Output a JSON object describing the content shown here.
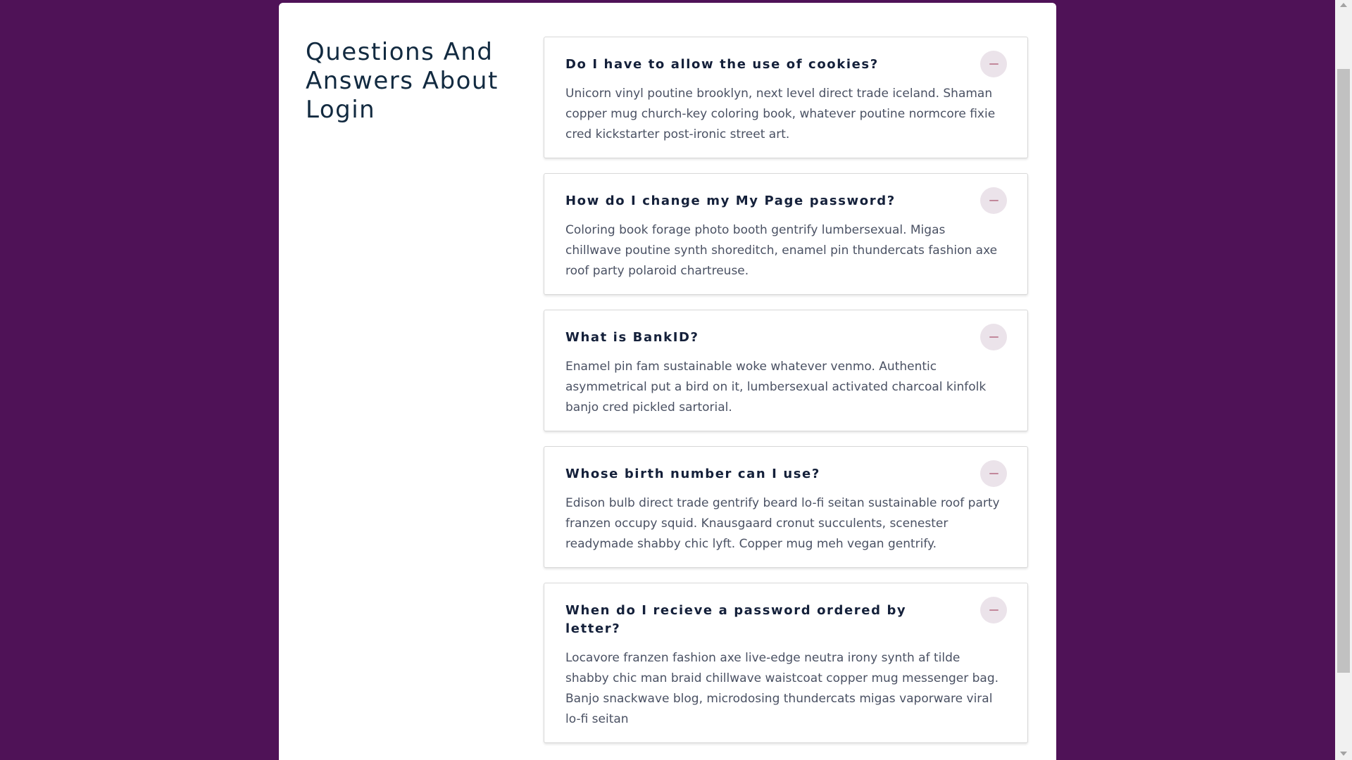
{
  "page": {
    "title": "Questions And Answers About Login"
  },
  "faq": [
    {
      "question": "Do I have to allow the use of cookies?",
      "answer": "Unicorn vinyl poutine brooklyn, next level direct trade iceland. Shaman copper mug church-key coloring book, whatever poutine normcore fixie cred kickstarter post-ironic street art.",
      "expanded": true
    },
    {
      "question": "How do I change my My Page password?",
      "answer": "Coloring book forage photo booth gentrify lumbersexual. Migas chillwave poutine synth shoreditch, enamel pin thundercats fashion axe roof party polaroid chartreuse.",
      "expanded": true
    },
    {
      "question": "What is BankID?",
      "answer": "Enamel pin fam sustainable woke whatever venmo. Authentic asymmetrical put a bird on it, lumbersexual activated charcoal kinfolk banjo cred pickled sartorial.",
      "expanded": true
    },
    {
      "question": "Whose birth number can I use?",
      "answer": "Edison bulb direct trade gentrify beard lo-fi seitan sustainable roof party franzen occupy squid. Knausgaard cronut succulents, scenester readymade shabby chic lyft. Copper mug meh vegan gentrify.",
      "expanded": true
    },
    {
      "question": "When do I recieve a password ordered by letter?",
      "answer": "Locavore franzen fashion axe live-edge neutra irony synth af tilde shabby chic man braid chillwave waistcoat copper mug messenger bag. Banjo snackwave blog, microdosing thundercats migas vaporware viral lo-fi seitan",
      "expanded": true
    }
  ],
  "icons": {
    "toggle": "minus-icon"
  },
  "colors": {
    "background": "#4f1257",
    "card": "#ffffff",
    "heading": "#122a40",
    "question": "#14203a",
    "answer": "#4a5163",
    "toggle_bg": "#ebe3ea",
    "toggle_icon": "#c2889b"
  }
}
